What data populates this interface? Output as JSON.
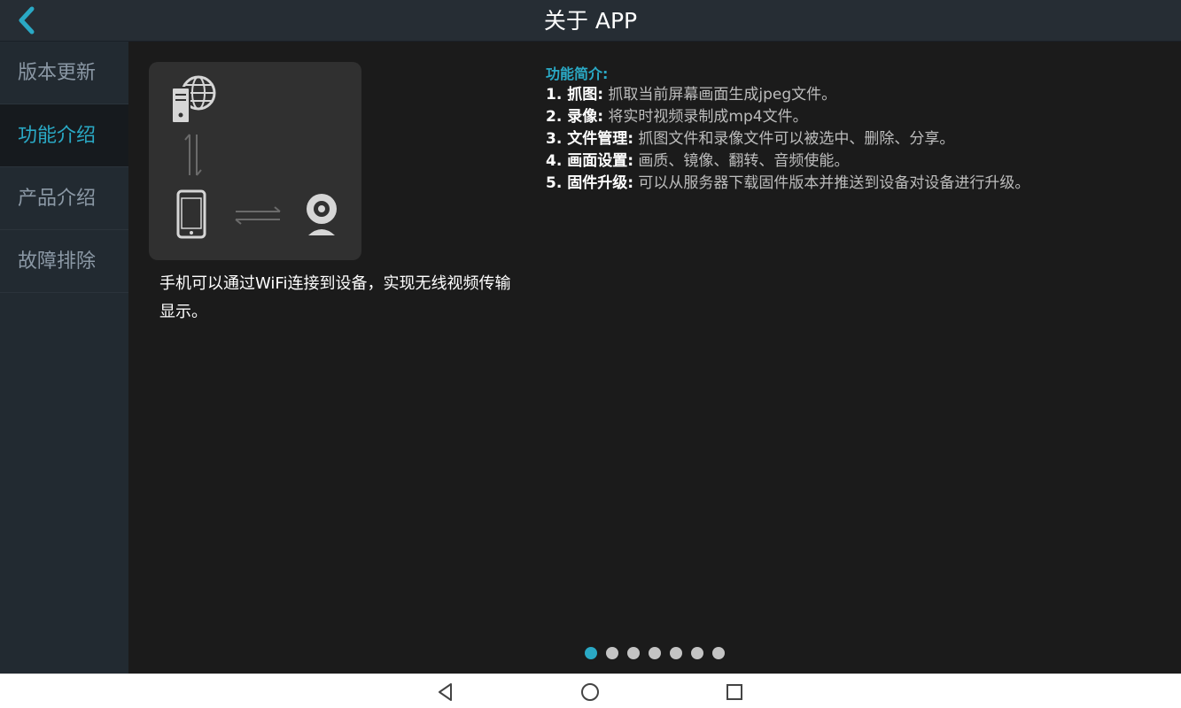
{
  "header": {
    "title": "关于 APP",
    "back_icon": "chevron-left-icon"
  },
  "sidebar": {
    "items": [
      {
        "label": "版本更新"
      },
      {
        "label": "功能介绍"
      },
      {
        "label": "产品介绍"
      },
      {
        "label": "故障排除"
      }
    ],
    "active_index": 1
  },
  "main": {
    "illustration_icons": [
      "server-globe-icon",
      "vertical-arrows-icon",
      "phone-icon",
      "horizontal-arrows-icon",
      "webcam-icon"
    ],
    "caption": "手机可以通过WiFi连接到设备，实现无线视频传输显示。",
    "intro": {
      "title": "功能简介:",
      "rows": [
        {
          "label": "1. 抓图:",
          "text": " 抓取当前屏幕画面生成jpeg文件。"
        },
        {
          "label": "2. 录像:",
          "text": " 将实时视频录制成mp4文件。"
        },
        {
          "label": "3. 文件管理:",
          "text": " 抓图文件和录像文件可以被选中、删除、分享。"
        },
        {
          "label": "4. 画面设置:",
          "text": " 画质、镜像、翻转、音频使能。"
        },
        {
          "label": "5. 固件升级:",
          "text": " 可以从服务器下载固件版本并推送到设备对设备进行升级。"
        }
      ]
    }
  },
  "pager": {
    "count": 7,
    "active_index": 0
  },
  "navbar": {
    "icons": [
      "back-triangle-icon",
      "home-circle-icon",
      "recents-square-icon"
    ]
  },
  "colors": {
    "accent": "#2aa9c5",
    "header_bg": "#262d34",
    "sidebar_bg": "#222a31",
    "content_bg": "#1b1b1b"
  }
}
